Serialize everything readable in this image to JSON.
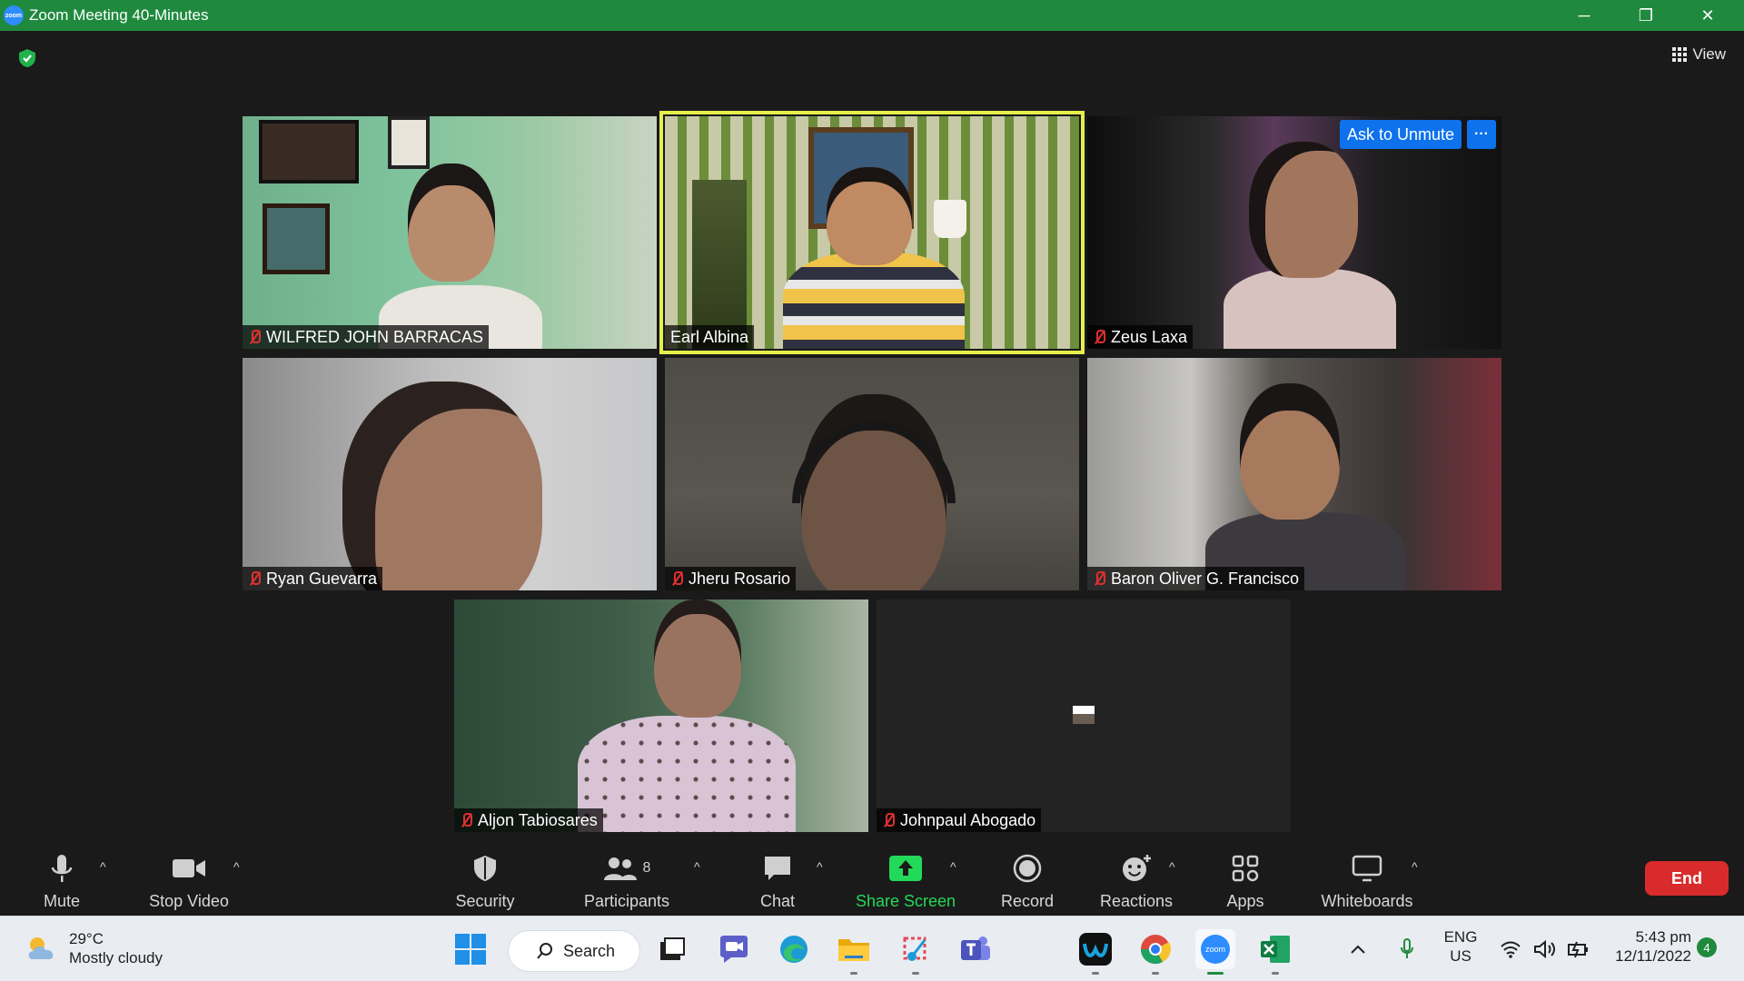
{
  "window": {
    "title": "Zoom Meeting 40-Minutes",
    "app_icon_text": "zoom",
    "controls": {
      "minimize": "─",
      "restore": "❐",
      "close": "✕"
    }
  },
  "header": {
    "view_label": "View"
  },
  "participants": [
    {
      "name": "WILFRED JOHN BARRACAS",
      "muted": true,
      "speaking": false
    },
    {
      "name": "Earl Albina",
      "muted": false,
      "speaking": true
    },
    {
      "name": "Zeus Laxa",
      "muted": true,
      "speaking": false
    },
    {
      "name": "Ryan Guevarra",
      "muted": true,
      "speaking": false
    },
    {
      "name": "Jheru Rosario",
      "muted": true,
      "speaking": false
    },
    {
      "name": "Baron Oliver G. Francisco",
      "muted": true,
      "speaking": false
    },
    {
      "name": "Aljon Tabiosares",
      "muted": true,
      "speaking": false
    },
    {
      "name": "Johnpaul Abogado",
      "muted": true,
      "speaking": false,
      "video_off": true
    }
  ],
  "hover_actions": {
    "ask_unmute": "Ask to Unmute",
    "more": "···"
  },
  "toolbar": {
    "mute": "Mute",
    "stop_video": "Stop Video",
    "security": "Security",
    "participants": "Participants",
    "participants_count": "8",
    "chat": "Chat",
    "share_screen": "Share Screen",
    "record": "Record",
    "reactions": "Reactions",
    "apps": "Apps",
    "whiteboards": "Whiteboards",
    "end": "End",
    "caret": "^"
  },
  "taskbar": {
    "weather_temp": "29°C",
    "weather_desc": "Mostly cloudy",
    "search_label": "Search",
    "lang_top": "ENG",
    "lang_bottom": "US",
    "time": "5:43 pm",
    "date": "12/11/2022",
    "notification_count": "4"
  },
  "colors": {
    "titlebar": "#1f8a3e",
    "active_speaker": "#e5f04a",
    "share_screen": "#23d959",
    "end_button": "#d92b2b",
    "accent_blue": "#0e72ed"
  }
}
